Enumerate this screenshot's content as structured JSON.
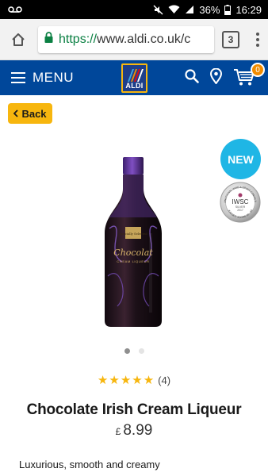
{
  "status_bar": {
    "battery": "36%",
    "time": "16:29",
    "icons": [
      "voicemail-icon",
      "mute-icon",
      "wifi-icon",
      "signal-icon",
      "battery-icon"
    ]
  },
  "browser": {
    "url_scheme": "https://",
    "url_rest": "www.aldi.co.uk/c",
    "tab_count": "3",
    "scheme_color": "#0b8043"
  },
  "header": {
    "menu_label": "MENU",
    "logo_text": "ALDI",
    "cart_count": "0",
    "background": "#00479a",
    "accent": "#f7b60e"
  },
  "product": {
    "back_label": "Back",
    "new_badge": "NEW",
    "award": {
      "top_text": "INTERNATIONAL WINE & SPIRIT COMPETITION",
      "name": "IWSC",
      "medal": "SILVER",
      "year": "2017",
      "bottom_text": "JUDGES' SCORE 90 - 94"
    },
    "bottle_label": {
      "brand": "Specially Selected",
      "name": "Chocolat",
      "sub": "CREAM LIQUEUR"
    },
    "carousel": {
      "total": 2,
      "active": 1
    },
    "rating": {
      "stars": "★★★★★",
      "value": 5,
      "count": "(4)"
    },
    "title": "Chocolate Irish Cream Liqueur",
    "currency": "£",
    "price": "8.99",
    "description": "Luxurious, smooth and creamy"
  }
}
